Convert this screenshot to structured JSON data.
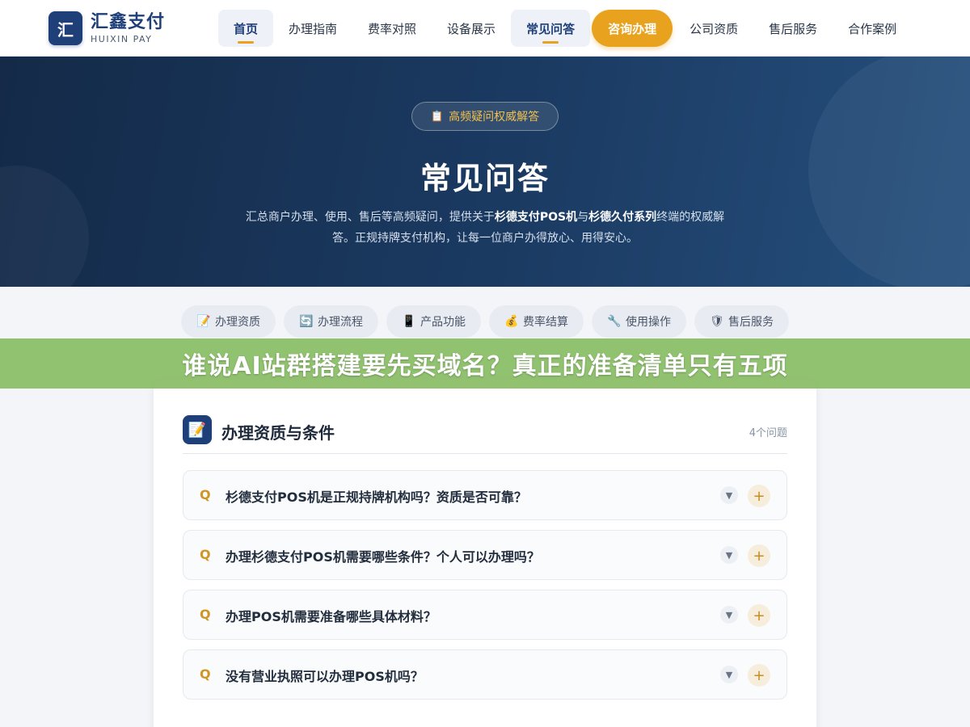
{
  "brand": {
    "mark": "汇",
    "name": "汇鑫支付",
    "sub": "HUIXIN PAY"
  },
  "nav": {
    "items": [
      {
        "label": "首页",
        "active": true
      },
      {
        "label": "办理指南"
      },
      {
        "label": "费率对照"
      },
      {
        "label": "设备展示"
      },
      {
        "label": "常见问答",
        "active": true
      },
      {
        "label": "咨询办理",
        "cta": true
      },
      {
        "label": "公司资质"
      },
      {
        "label": "售后服务"
      },
      {
        "label": "合作案例"
      }
    ]
  },
  "hero": {
    "badge_icon": "clipboard-icon",
    "badge": "高频疑问权威解答",
    "title": "常见问答",
    "desc_part1": "汇总商户办理、使用、售后等高频疑问，提供关于",
    "desc_bold1": "杉德支付POS机",
    "desc_part2": "与",
    "desc_bold2": "杉德久付系列",
    "desc_part3": "终端的权威解答。正规持牌支付机构，让每一位商户办得放心、用得安心。"
  },
  "categories": [
    {
      "label": "办理资质",
      "icon": "memo-icon",
      "glyph": "📝"
    },
    {
      "label": "办理流程",
      "icon": "refresh-icon",
      "glyph": "🔄"
    },
    {
      "label": "产品功能",
      "icon": "phone-icon",
      "glyph": "📱"
    },
    {
      "label": "费率结算",
      "icon": "money-bag-icon",
      "glyph": "💰"
    },
    {
      "label": "使用操作",
      "icon": "wrench-icon",
      "glyph": "🔧"
    },
    {
      "label": "售后服务",
      "icon": "shield-icon",
      "glyph": "🛡"
    }
  ],
  "banner": {
    "text": "谁说AI站群搭建要先买域名？真正的准备清单只有五项"
  },
  "faq": {
    "section_icon": "memo-icon",
    "title": "办理资质与条件",
    "count": "4个问题",
    "mark": "Q",
    "questions": [
      "杉德支付POS机是正规持牌机构吗？资质是否可靠？",
      "办理杉德支付POS机需要哪些条件？个人可以办理吗？",
      "办理POS机需要准备哪些具体材料？",
      "没有营业执照可以办理POS机吗？"
    ]
  },
  "colors": {
    "brand": "#1f3f79",
    "accent": "#e8a21e",
    "banner": "#89bd64",
    "hero": "#1b3b63"
  }
}
